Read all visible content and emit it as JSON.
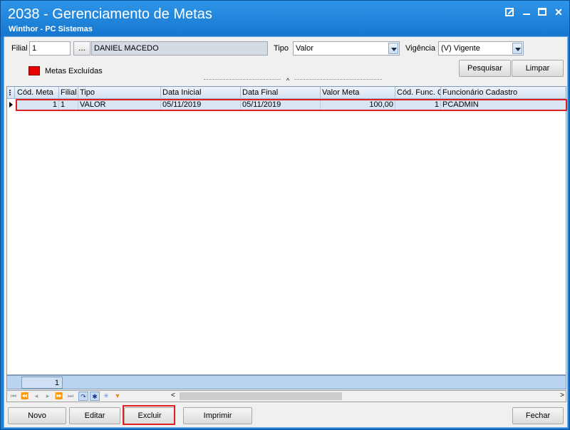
{
  "window": {
    "title": "2038 - Gerenciamento de Metas",
    "subtitle": "Winthor - PC Sistemas"
  },
  "filters": {
    "filial_label": "Filial",
    "filial_value": "1",
    "filial_lookup_label": "...",
    "filial_name": "DANIEL MACEDO",
    "tipo_label": "Tipo",
    "tipo_value": "Valor",
    "vigencia_label": "Vigência",
    "vigencia_value": "(V) Vigente",
    "legend_label": "Metas Excluídas",
    "legend_color": "#e60000",
    "pesquisar_label": "Pesquisar",
    "limpar_label": "Limpar"
  },
  "grid": {
    "columns": [
      "Cód. Meta",
      "Filial",
      "Tipo",
      "Data Inicial",
      "Data Final",
      "Valor Meta",
      "Cód. Func. C",
      "Funcionário Cadastro"
    ],
    "rows": [
      [
        "1",
        "1",
        "VALOR",
        "05/11/2019",
        "05/11/2019",
        "100,00",
        "1",
        "PCADMIN"
      ]
    ],
    "footer_count": "1"
  },
  "actions": {
    "novo": "Novo",
    "editar": "Editar",
    "excluir": "Excluir",
    "imprimir": "Imprimir",
    "fechar": "Fechar"
  },
  "colors": {
    "titlebar": "#1a7fd6",
    "highlight": "#e02020",
    "selected_row": "#d9e5f4"
  }
}
